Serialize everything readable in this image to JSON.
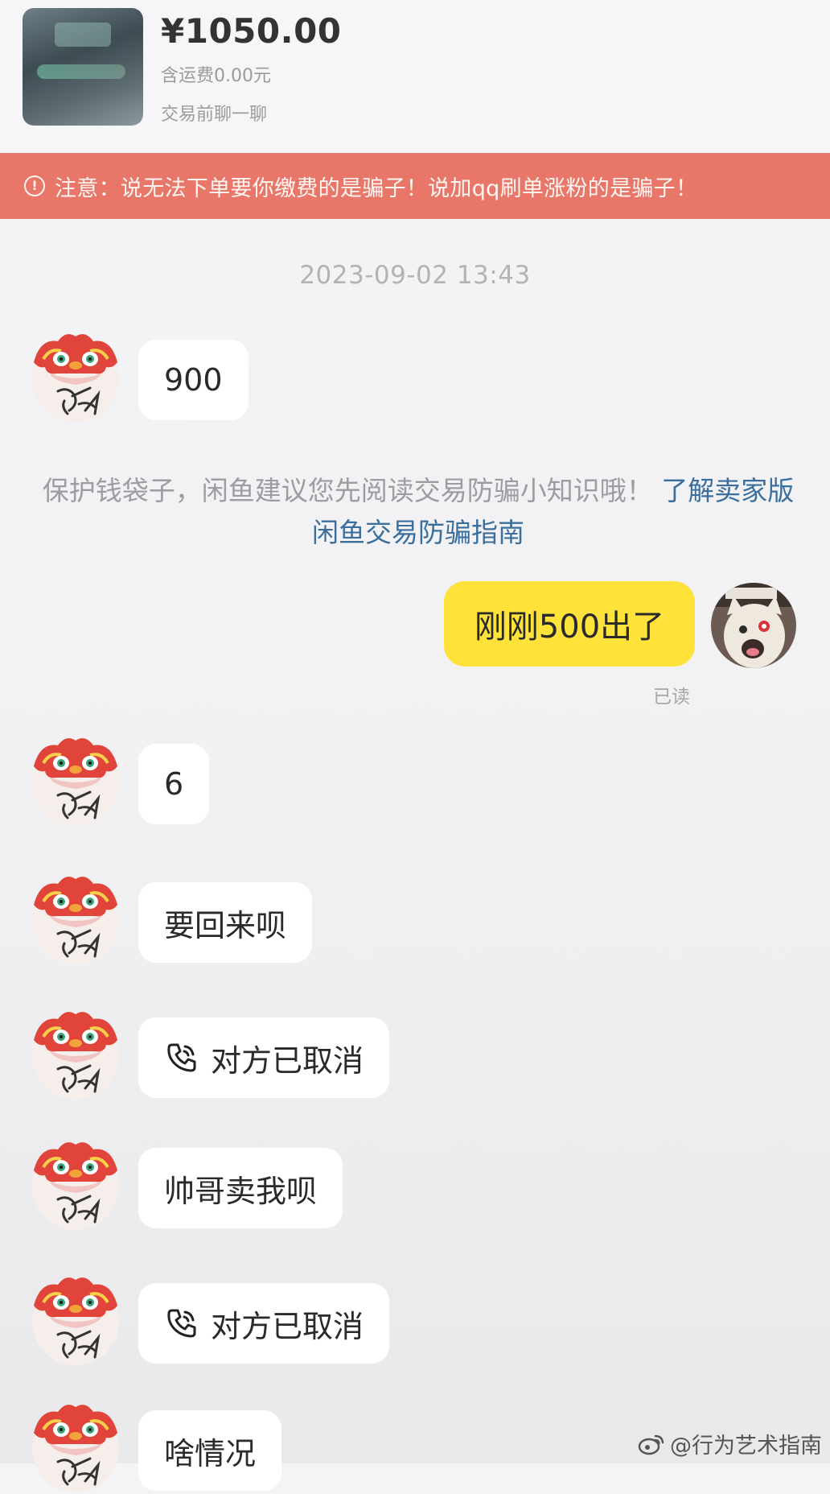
{
  "product": {
    "price": "¥1050.00",
    "shipping": "含运费0.00元",
    "chat_hint": "交易前聊一聊"
  },
  "warning": {
    "icon": "info-circle-icon",
    "text": "注意：说无法下单要你缴费的是骗子！说加qq刷单涨粉的是骗子！"
  },
  "chat": {
    "timestamp": "2023-09-02 13:43",
    "messages": [
      {
        "sender": "seller",
        "text": "900"
      },
      {
        "sender": "seller",
        "text": "6"
      },
      {
        "sender": "seller",
        "text": "要回来呗"
      },
      {
        "sender": "seller",
        "type": "call",
        "text": "对方已取消"
      },
      {
        "sender": "seller",
        "text": "帅哥卖我呗"
      },
      {
        "sender": "seller",
        "type": "call",
        "text": "对方已取消"
      },
      {
        "sender": "seller",
        "text": "啥情况"
      }
    ],
    "notice": {
      "text": "保护钱袋子，闲鱼建议您先阅读交易防骗小知识哦！",
      "link": "了解卖家版闲鱼交易防骗指南"
    },
    "outgoing": {
      "text": "刚刚500出了",
      "status": "已读"
    }
  },
  "watermark": {
    "text": "@行为艺术指南",
    "icon": "weibo-icon"
  },
  "colors": {
    "warning_bg": "#e97769",
    "outgoing_bubble": "#ffe33a",
    "link": "#3a6e9c",
    "timestamp": "#b3b3b6"
  }
}
